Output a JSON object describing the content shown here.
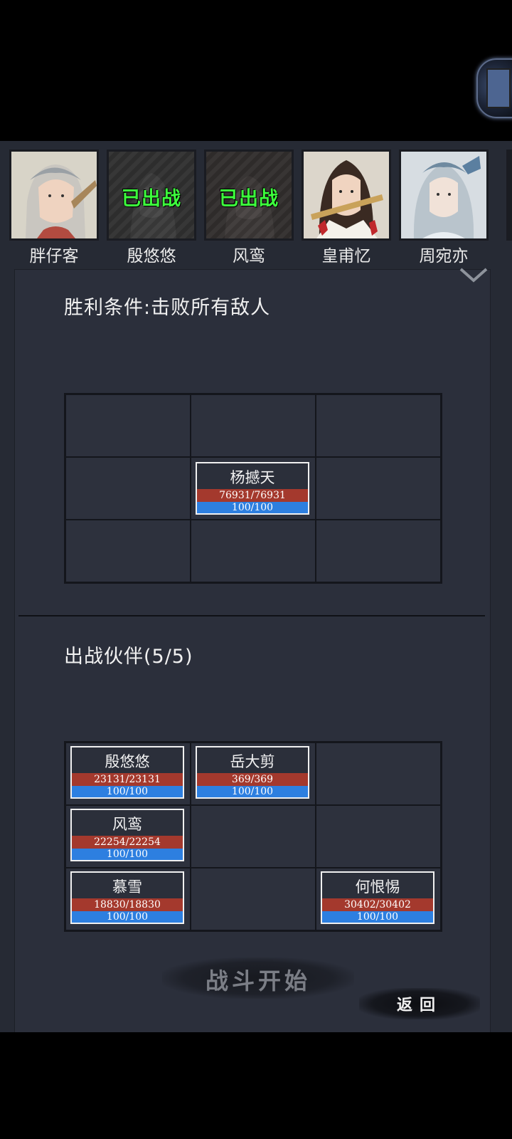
{
  "party_strip": {
    "portraits": [
      {
        "name": "胖仔客",
        "status": ""
      },
      {
        "name": "殷悠悠",
        "status": "已出战"
      },
      {
        "name": "风鸾",
        "status": "已出战"
      },
      {
        "name": "皇甫忆",
        "status": ""
      },
      {
        "name": "周宛亦",
        "status": ""
      }
    ]
  },
  "victory": {
    "label": "胜利条件:击败所有敌人"
  },
  "enemy_grid": {
    "units": [
      {
        "name": "杨撼天",
        "hp": "76931/76931",
        "mp": "100/100"
      }
    ]
  },
  "party": {
    "label": "出战伙伴(5/5)",
    "units": [
      {
        "name": "殷悠悠",
        "hp": "23131/23131",
        "mp": "100/100"
      },
      {
        "name": "岳大剪",
        "hp": "369/369",
        "mp": "100/100"
      },
      {
        "name": "风鸾",
        "hp": "22254/22254",
        "mp": "100/100"
      },
      {
        "name": "慕雪",
        "hp": "18830/18830",
        "mp": "100/100"
      },
      {
        "name": "何恨惕",
        "hp": "30402/30402",
        "mp": "100/100"
      }
    ]
  },
  "actions": {
    "start": "战斗开始",
    "back": "返回"
  },
  "colors": {
    "used_status": "#3dff3d",
    "hp_bar": "#a4392d",
    "mp_bar": "#2d7fe0",
    "panel_bg": "#2b2f3b"
  },
  "icons": {
    "collapse": "chevron-down-icon"
  }
}
